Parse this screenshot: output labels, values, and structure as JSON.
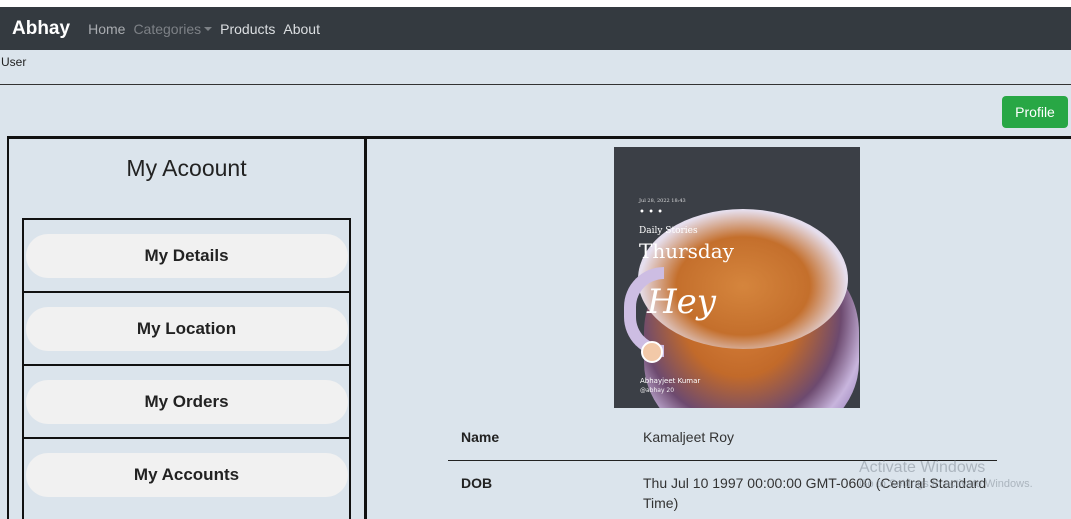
{
  "navbar": {
    "brand": "Abhay",
    "links": {
      "home": "Home",
      "categories": "Categories",
      "products": "Products",
      "about": "About"
    }
  },
  "user_label": "User",
  "profile_button": "Profile",
  "account": {
    "title": "My Acoount",
    "menu": [
      "My Details",
      "My Location",
      "My Orders",
      "My Accounts"
    ]
  },
  "photo": {
    "date": "Jul 28, 2022 18:43",
    "dots": "• • •",
    "subtitle": "Daily Stories",
    "day": "Thursday",
    "greeting": "Hey",
    "author": "Abhayjeet Kumar",
    "handle": "@abhay 20"
  },
  "details": {
    "name_label": "Name",
    "name_value": "Kamaljeet Roy",
    "dob_label": "DOB",
    "dob_value": "Thu Jul 10 1997 00:00:00 GMT-0600 (Central Standard Time)"
  },
  "watermark": {
    "line1": "Activate Windows",
    "line2": "Go to Settings to activate Windows."
  }
}
